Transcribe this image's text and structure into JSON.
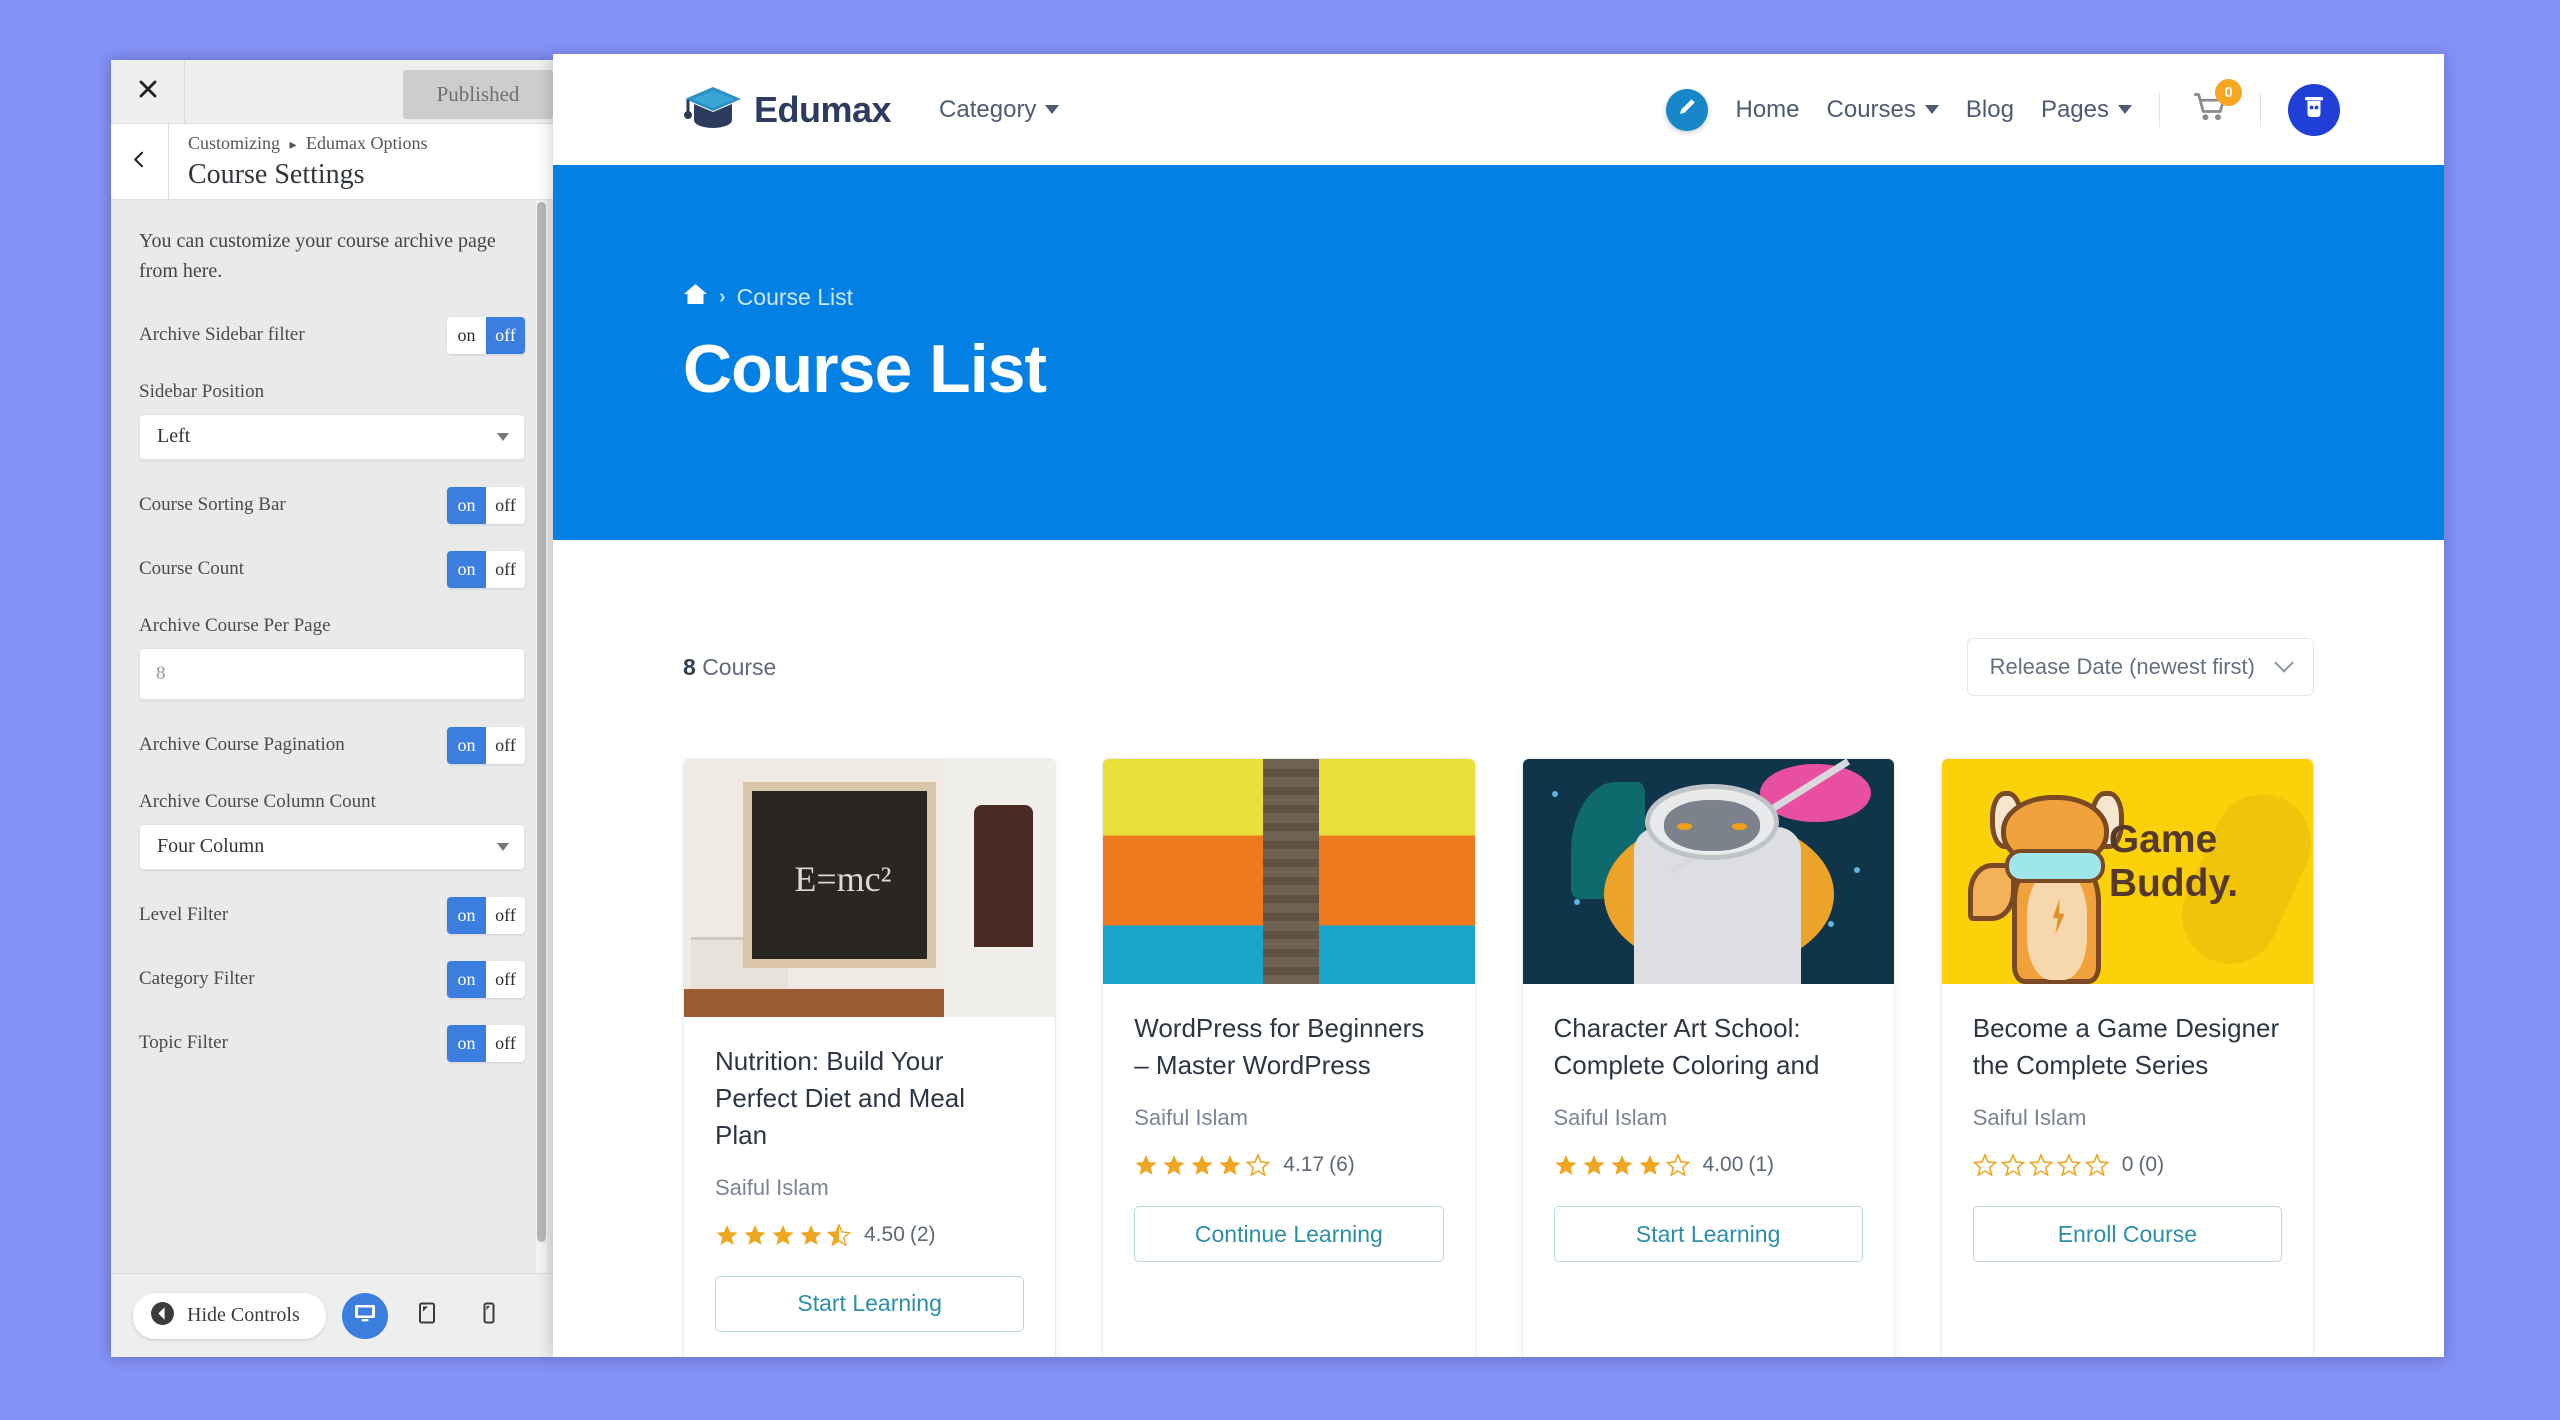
{
  "customizer": {
    "close_icon": "close-icon",
    "publish_label": "Published",
    "back_icon": "chevron-left-icon",
    "breadcrumb_root": "Customizing",
    "breadcrumb_sep": "▸",
    "breadcrumb_parent": "Edumax Options",
    "panel_title": "Course Settings",
    "description": "You can customize your course archive page from here.",
    "controls": [
      {
        "type": "toggle",
        "label": "Archive Sidebar filter",
        "on_label": "on",
        "off_label": "off",
        "value": "off"
      },
      {
        "type": "select",
        "label": "Sidebar Position",
        "value": "Left"
      },
      {
        "type": "toggle",
        "label": "Course Sorting Bar",
        "on_label": "on",
        "off_label": "off",
        "value": "on"
      },
      {
        "type": "toggle",
        "label": "Course Count",
        "on_label": "on",
        "off_label": "off",
        "value": "on"
      },
      {
        "type": "input",
        "label": "Archive Course Per Page",
        "value": "8"
      },
      {
        "type": "toggle",
        "label": "Archive Course Pagination",
        "on_label": "on",
        "off_label": "off",
        "value": "on"
      },
      {
        "type": "select",
        "label": "Archive Course Column Count",
        "value": "Four Column"
      },
      {
        "type": "toggle",
        "label": "Level Filter",
        "on_label": "on",
        "off_label": "off",
        "value": "on"
      },
      {
        "type": "toggle",
        "label": "Category Filter",
        "on_label": "on",
        "off_label": "off",
        "value": "on"
      },
      {
        "type": "toggle",
        "label": "Topic Filter",
        "on_label": "on",
        "off_label": "off",
        "value": "on"
      }
    ],
    "footer": {
      "hide_controls_label": "Hide Controls",
      "hide_controls_icon": "collapse-left-icon",
      "devices": [
        {
          "icon": "desktop-icon",
          "active": true
        },
        {
          "icon": "tablet-icon",
          "active": false
        },
        {
          "icon": "mobile-icon",
          "active": false
        }
      ]
    }
  },
  "site": {
    "brand_name": "Edumax",
    "brand_icon": "graduation-cap-icon",
    "category_label": "Category",
    "nav": [
      {
        "label": "Home",
        "has_caret": false
      },
      {
        "label": "Courses",
        "has_caret": true
      },
      {
        "label": "Blog",
        "has_caret": false
      },
      {
        "label": "Pages",
        "has_caret": true
      }
    ],
    "edit_icon": "pencil-icon",
    "cart_icon": "cart-icon",
    "cart_count": "0",
    "avatar_icon": "user-avatar-icon",
    "hero": {
      "home_icon": "home-icon",
      "crumb_sep": "›",
      "breadcrumb": "Course List",
      "title": "Course List",
      "bg_color": "#0380e4"
    },
    "listing": {
      "count_number": "8",
      "count_suffix": "Course",
      "sort_value": "Release Date (newest first)",
      "sort_caret_icon": "chevron-down-icon"
    },
    "courses": [
      {
        "thumb": "blackboard-equation-photo",
        "thumb_text": "E=mc²",
        "title": "Nutrition: Build Your Perfect Diet and Meal Plan",
        "author": "Saiful Islam",
        "stars": [
          1,
          1,
          1,
          1,
          0.5
        ],
        "rating": "4.50",
        "reviews": "(2)",
        "button": "Start Learning"
      },
      {
        "thumb": "palm-trunk-colorful-photo",
        "thumb_text": "",
        "title": "WordPress for Beginners – Master WordPress",
        "author": "Saiful Islam",
        "stars": [
          1,
          1,
          1,
          1,
          0
        ],
        "rating": "4.17",
        "reviews": "(6)",
        "button": "Continue Learning"
      },
      {
        "thumb": "space-astronaut-ape-illustration",
        "thumb_text": "",
        "title": "Character Art School: Complete Coloring and",
        "author": "Saiful Islam",
        "stars": [
          1,
          1,
          1,
          1,
          0
        ],
        "rating": "4.00",
        "reviews": "(1)",
        "button": "Start Learning"
      },
      {
        "thumb": "game-buddy-dog-illustration",
        "thumb_text": "Game Buddy.",
        "title": "Become a Game Designer the Complete Series",
        "author": "Saiful Islam",
        "stars": [
          0,
          0,
          0,
          0,
          0
        ],
        "rating": "0",
        "reviews": "(0)",
        "button": "Enroll Course"
      }
    ]
  },
  "colors": {
    "accent_blue": "#3b7ede",
    "hero_blue": "#0380e4",
    "star_gold": "#efa621",
    "button_teal": "#2b8fa8",
    "page_bg": "#8491f7"
  }
}
